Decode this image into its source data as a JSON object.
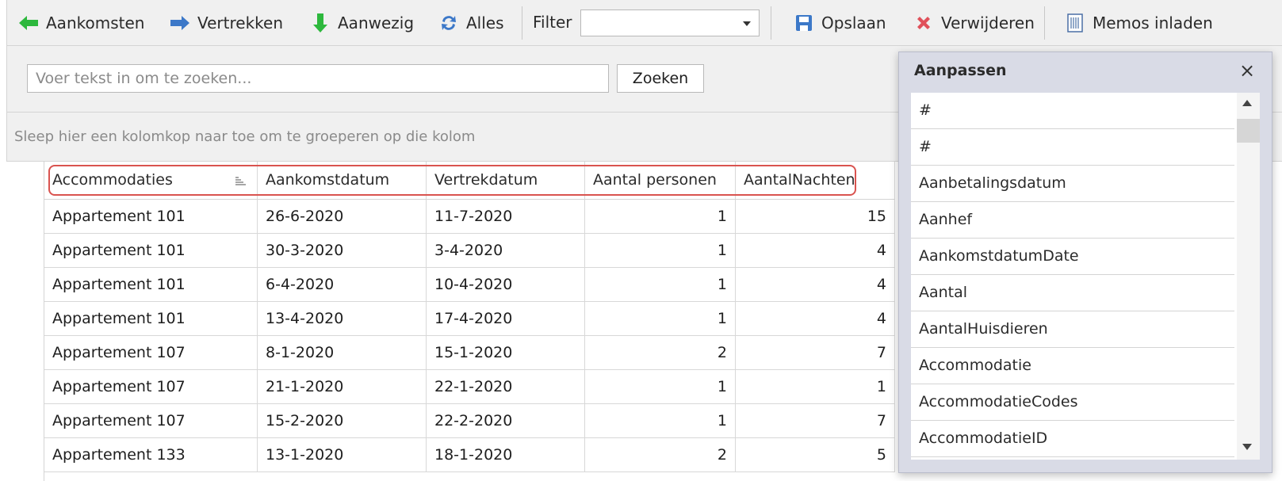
{
  "toolbar": {
    "arrivals": "Aankomsten",
    "departures": "Vertrekken",
    "present": "Aanwezig",
    "all": "Alles",
    "filter_label": "Filter",
    "filter_value": "",
    "save": "Opslaan",
    "delete": "Verwijderen",
    "load_memos": "Memos inladen",
    "icons": [
      "arrow-left-icon",
      "arrow-right-icon",
      "arrow-down-icon",
      "refresh-icon",
      "save-icon",
      "delete-x-icon",
      "memo-icon"
    ],
    "colors": {
      "green": "#2db83d",
      "blue": "#3c78c8",
      "red": "#e0505a"
    }
  },
  "search": {
    "placeholder": "Voer tekst in om te zoeken...",
    "button": "Zoeken"
  },
  "group_panel": {
    "text": "Sleep hier een kolomkop naar toe om te groeperen op die kolom"
  },
  "grid": {
    "columns": [
      "Accommodaties",
      "Aankomstdatum",
      "Vertrekdatum",
      "Aantal personen",
      "AantalNachten"
    ],
    "rows": [
      [
        "Appartement 101",
        "26-6-2020",
        "11-7-2020",
        "1",
        "15"
      ],
      [
        "Appartement 101",
        "30-3-2020",
        "3-4-2020",
        "1",
        "4"
      ],
      [
        "Appartement 101",
        "6-4-2020",
        "10-4-2020",
        "1",
        "4"
      ],
      [
        "Appartement 101",
        "13-4-2020",
        "17-4-2020",
        "1",
        "4"
      ],
      [
        "Appartement 107",
        "8-1-2020",
        "15-1-2020",
        "2",
        "7"
      ],
      [
        "Appartement 107",
        "21-1-2020",
        "22-1-2020",
        "1",
        "1"
      ],
      [
        "Appartement 107",
        "15-2-2020",
        "22-2-2020",
        "1",
        "7"
      ],
      [
        "Appartement 133",
        "13-1-2020",
        "18-1-2020",
        "2",
        "5"
      ]
    ],
    "highlight_color": "#d9534f"
  },
  "customization": {
    "title": "Aanpassen",
    "close": "×",
    "items": [
      "#",
      "#",
      "Aanbetalingsdatum",
      "Aanhef",
      "AankomstdatumDate",
      "Aantal",
      "AantalHuisdieren",
      "Accommodatie",
      "AccommodatieCodes",
      "AccommodatieID"
    ]
  }
}
